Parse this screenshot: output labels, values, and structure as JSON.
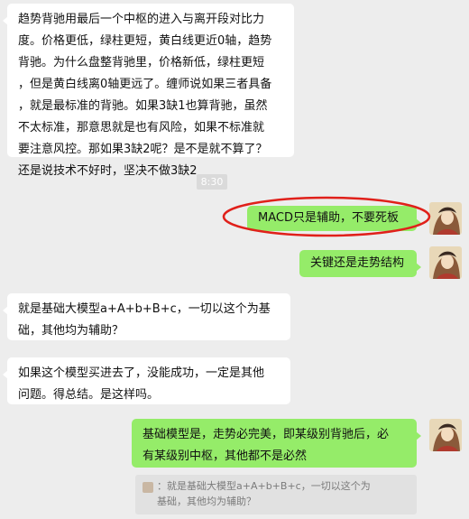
{
  "messages": {
    "m1": {
      "lines": [
        "趋势背驰用最后一个中枢的进入与离开段对比力",
        "度。价格更低，绿柱更短，黄白线更近0轴，趋势",
        "背驰。为什么盘整背驰里，价格新低，绿柱更短",
        "，但是黄白线离0轴更远了。缠师说如果三者具备",
        "，就是最标准的背驰。如果3缺1也算背驰，虽然",
        "不太标准，那意思就是也有风险，如果不标准就",
        "要注意风控。那如果3缺2呢？是不是就不算了？",
        "还是说技术不好时，坚决不做3缺2"
      ]
    },
    "time": "8:30",
    "m2": "MACD只是辅助，不要死板",
    "m3": "关键还是走势结构",
    "m4": {
      "lines": [
        "就是基础大模型a+A+b+B+c，一切以这个为基",
        "础，其他均为辅助？"
      ]
    },
    "m5": {
      "lines": [
        "如果这个模型买进去了，没能成功，一定是其他",
        "问题。得总结。是这样吗。"
      ]
    },
    "m6": {
      "lines": [
        "基础模型是，走势必完美，即某级别背驰后，必",
        "有某级别中枢，其他都不是必然"
      ]
    },
    "quote": {
      "lines": [
        "：就是基础大模型a+A+b+B+c，一切以这个为",
        "基础，其他均为辅助？"
      ]
    }
  },
  "colors": {
    "background": "#ededed",
    "sent_bubble": "#95ec69",
    "received_bubble": "#ffffff",
    "annotation_circle": "#e0201a"
  }
}
